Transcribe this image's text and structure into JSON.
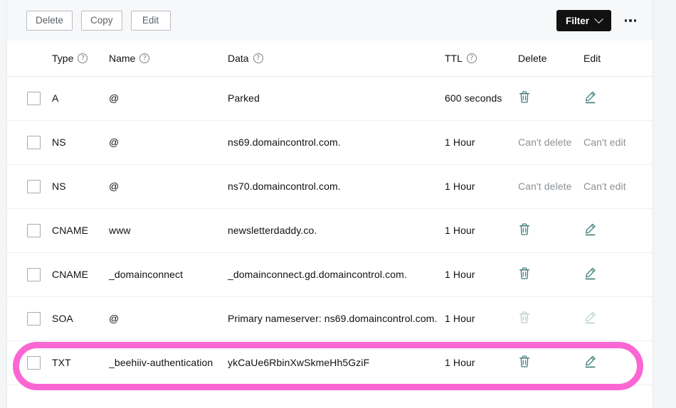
{
  "toolbar": {
    "buttons": [
      {
        "label": "Delete",
        "name": "delete-button"
      },
      {
        "label": "Copy",
        "name": "copy-button"
      },
      {
        "label": "Edit",
        "name": "edit-button"
      }
    ],
    "filter_label": "Filter",
    "more_label": "•••"
  },
  "table": {
    "columns": [
      {
        "label": "",
        "help": false
      },
      {
        "label": "Type",
        "help": true
      },
      {
        "label": "Name",
        "help": true
      },
      {
        "label": "Data",
        "help": true
      },
      {
        "label": "TTL",
        "help": true
      },
      {
        "label": "Delete",
        "help": false
      },
      {
        "label": "Edit",
        "help": false
      }
    ],
    "help_glyph": "?",
    "rows": [
      {
        "type": "A",
        "name": "@",
        "data": "Parked",
        "ttl": "600 seconds",
        "delete": {
          "kind": "icon",
          "label": "trash-icon"
        },
        "edit": {
          "kind": "icon",
          "label": "pencil-icon"
        },
        "highlighted": false
      },
      {
        "type": "NS",
        "name": "@",
        "data": "ns69.domaincontrol.com.",
        "ttl": "1 Hour",
        "delete": {
          "kind": "text",
          "label": "Can't delete"
        },
        "edit": {
          "kind": "text",
          "label": "Can't edit"
        },
        "highlighted": false
      },
      {
        "type": "NS",
        "name": "@",
        "data": "ns70.domaincontrol.com.",
        "ttl": "1 Hour",
        "delete": {
          "kind": "text",
          "label": "Can't delete"
        },
        "edit": {
          "kind": "text",
          "label": "Can't edit"
        },
        "highlighted": false
      },
      {
        "type": "CNAME",
        "name": "www",
        "data": "newsletterdaddy.co.",
        "ttl": "1 Hour",
        "delete": {
          "kind": "icon",
          "label": "trash-icon"
        },
        "edit": {
          "kind": "icon",
          "label": "pencil-icon"
        },
        "highlighted": false
      },
      {
        "type": "CNAME",
        "name": "_domainconnect",
        "data": "_domainconnect.gd.domaincontrol.com.",
        "ttl": "1 Hour",
        "delete": {
          "kind": "icon",
          "label": "trash-icon"
        },
        "edit": {
          "kind": "icon",
          "label": "pencil-icon"
        },
        "highlighted": false
      },
      {
        "type": "SOA",
        "name": "@",
        "data": "Primary nameserver: ns69.domaincontrol.com.",
        "ttl": "1 Hour",
        "delete": {
          "kind": "icon-disabled",
          "label": "trash-icon"
        },
        "edit": {
          "kind": "icon-disabled",
          "label": "pencil-icon"
        },
        "highlighted": false
      },
      {
        "type": "TXT",
        "name": "_beehiiv-authentication",
        "data": "ykCaUe6RbinXwSkmeHh5GziF",
        "ttl": "1 Hour",
        "delete": {
          "kind": "icon",
          "label": "trash-icon"
        },
        "edit": {
          "kind": "icon",
          "label": "pencil-icon"
        },
        "highlighted": true
      }
    ]
  },
  "colors": {
    "highlight_ring": "#fb66d3",
    "icon_teal": "#3f7d7a",
    "filter_bg": "#111111",
    "page_bg": "#f4f5f6",
    "toolbar_bg": "#f7f8f9"
  }
}
